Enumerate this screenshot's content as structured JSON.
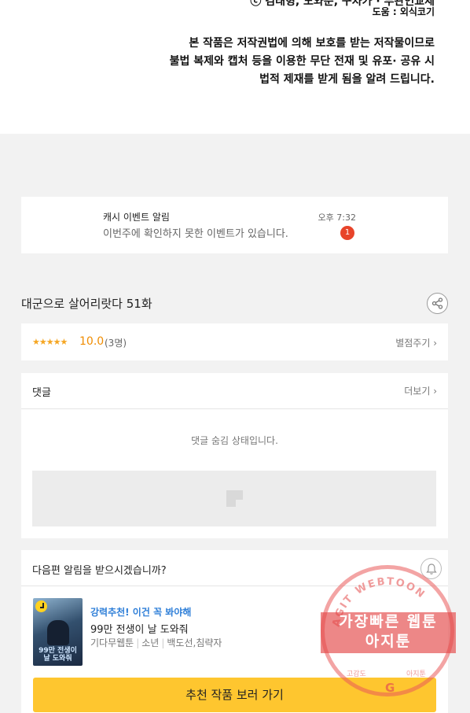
{
  "credits": {
    "line1": "ⓒ 김태형, 도와준, 구차가 · 부관인교체",
    "line2": "도움 : 외식코기"
  },
  "notice": {
    "line1": "본 작품은 저작권법에 의해 보호를 받는 저작물이므로",
    "line2": "불법 복제와 캡처 등을 이용한 무단 전재 및 유포· 공유 시",
    "line3": "법적 제재를 받게 됨을 알려 드립니다."
  },
  "event_alert": {
    "title": "캐시 이벤트 알림",
    "message": "이번주에 확인하지 못한 이벤트가 있습니다.",
    "time": "오후 7:32",
    "badge": "1"
  },
  "episode": {
    "title": "대군으로 살어리랏다 51화",
    "share_icon": "share-icon"
  },
  "rating": {
    "stars": "★★★★★",
    "score": "10.0",
    "count": "(3명)",
    "rate_label": "별점주기 ›"
  },
  "comments": {
    "title": "댓글",
    "more_label": "더보기 ›",
    "hidden_message": "댓글 숨김 상태입니다."
  },
  "next_episode": {
    "question": "다음편 알림을 받으시겠습니까?",
    "bell_icon": "bell-icon",
    "recommendation": {
      "tag": "강력추천! 이건 꼭 봐야해",
      "title": "99만 전생이 날 도와줘",
      "thumbnail_text": "99만 전생이 날 도와줘",
      "meta": [
        "기다무웹툰",
        "소년",
        "백도선,침략자"
      ]
    },
    "button_label": "추천 작품 보러 가기"
  },
  "watermark": {
    "arc_text": "AGIT WEBTOON",
    "band_line1": "가장빠른 웹툰",
    "band_line2": "아지툰",
    "bottom_left": "고감도",
    "bottom_right": "아지툰",
    "logo": "G"
  },
  "colors": {
    "accent_button": "#fec62f",
    "score": "#f08c00",
    "badge": "#e8442a",
    "tag": "#2f7fd8"
  }
}
